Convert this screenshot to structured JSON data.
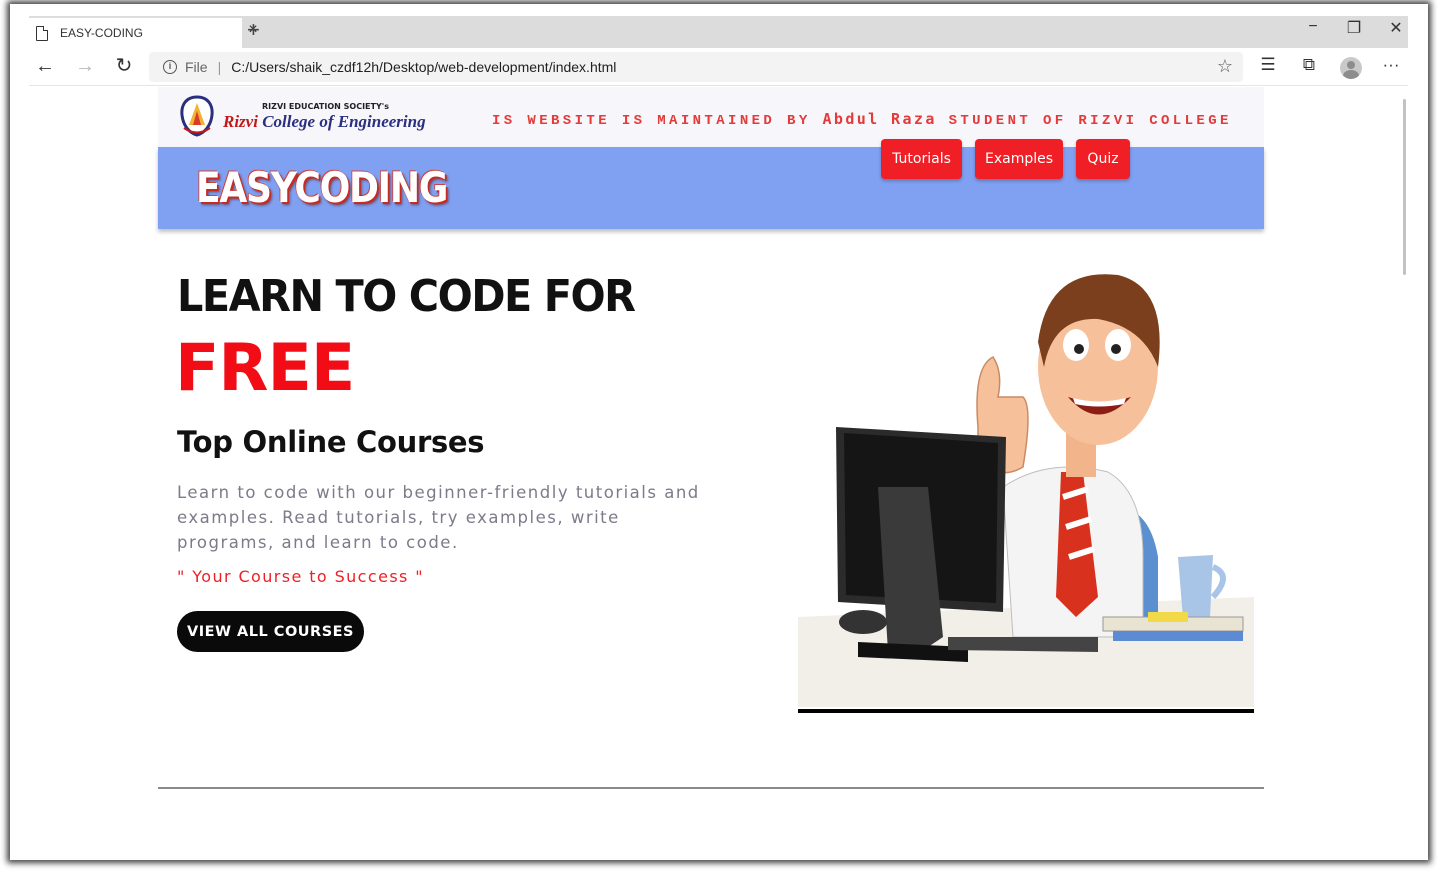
{
  "browser": {
    "tab_title": "EASY-CODING",
    "tab_close": "×",
    "new_tab": "+",
    "window_controls": {
      "minimize": "−",
      "maximize": "❐",
      "close": "✕"
    },
    "nav": {
      "back": "←",
      "forward": "→",
      "reload": "↻"
    },
    "address": {
      "info": "i",
      "scheme": "File",
      "separator": "|",
      "url": "C:/Users/shaik_czdf12h/Desktop/web-development/index.html"
    },
    "icons": {
      "favorite": "☆",
      "favorites_list": "☰",
      "collections": "⧉",
      "menu": "···"
    }
  },
  "site": {
    "college_small": "RIZVI EDUCATION SOCIETY's",
    "college_name_part1": "Rizvi",
    "college_name_part2": " College of Engineering",
    "marquee_before": "IS WEBSITE IS MAINTAINED BY ",
    "marquee_name": "Abdul Raza",
    "marquee_after": " STUDENT OF RIZVI COLLEGE",
    "brand": "EASYCODING",
    "nav": [
      "Tutorials",
      "Examples",
      "Quiz"
    ],
    "hero": {
      "heading_line1": "LEARN TO CODE FOR",
      "heading_line2": "FREE",
      "subheading": "Top Online Courses",
      "description": "Learn to code with our beginner-friendly tutorials and examples. Read tutorials, try examples, write programs, and learn to code.",
      "tagline": "\" Your Course to Success \"",
      "cta": "VIEW ALL COURSES"
    }
  },
  "colors": {
    "nav_bar": "#80a0f2",
    "accent_red": "#f01f25",
    "cta_bg": "#0a0a0a"
  }
}
